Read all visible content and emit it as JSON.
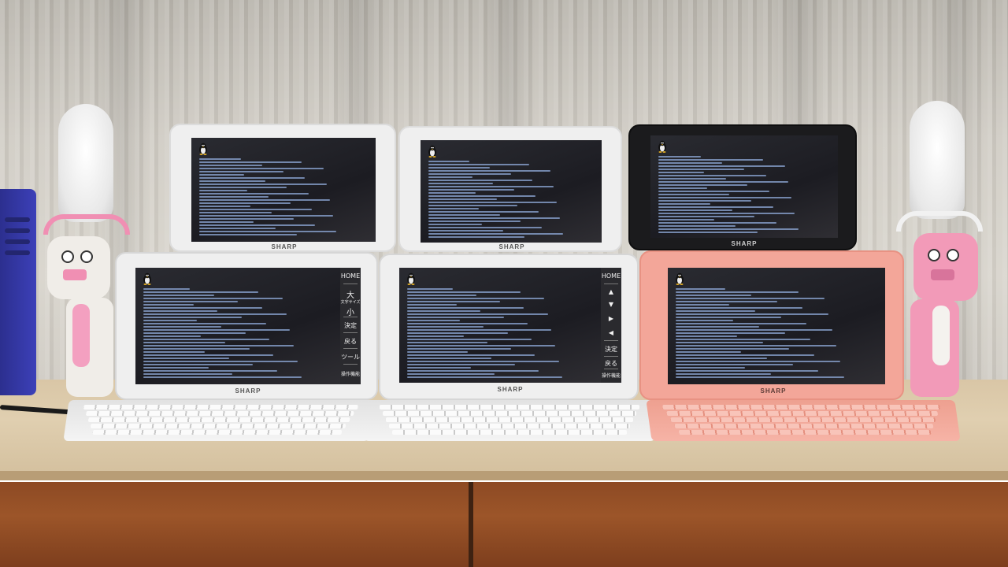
{
  "devices": [
    {
      "id": "top-left",
      "brand": "SHARP",
      "color": "white"
    },
    {
      "id": "top-center",
      "brand": "SHARP",
      "color": "white"
    },
    {
      "id": "top-right",
      "brand": "SHARP",
      "color": "black"
    },
    {
      "id": "bottom-left",
      "brand": "SHARP",
      "color": "white",
      "side_buttons": [
        "HOME",
        "大",
        "文字サイズ",
        "小",
        "決定",
        "戻る",
        "ツール",
        "操作機能"
      ]
    },
    {
      "id": "bottom-center",
      "brand": "SHARP",
      "color": "white",
      "side_buttons": [
        "HOME",
        "▲",
        "▼",
        "▶",
        "◀",
        "決定",
        "戻る",
        "操作機能"
      ]
    },
    {
      "id": "bottom-right",
      "brand": "SHARP",
      "color": "pink"
    }
  ],
  "colors": {
    "lcd_text": "#8fa9d8",
    "white_shell": "#ececec",
    "black_shell": "#1b1b1d",
    "pink_shell": "#f3a699",
    "mascot_pink": "#f29ab8"
  }
}
